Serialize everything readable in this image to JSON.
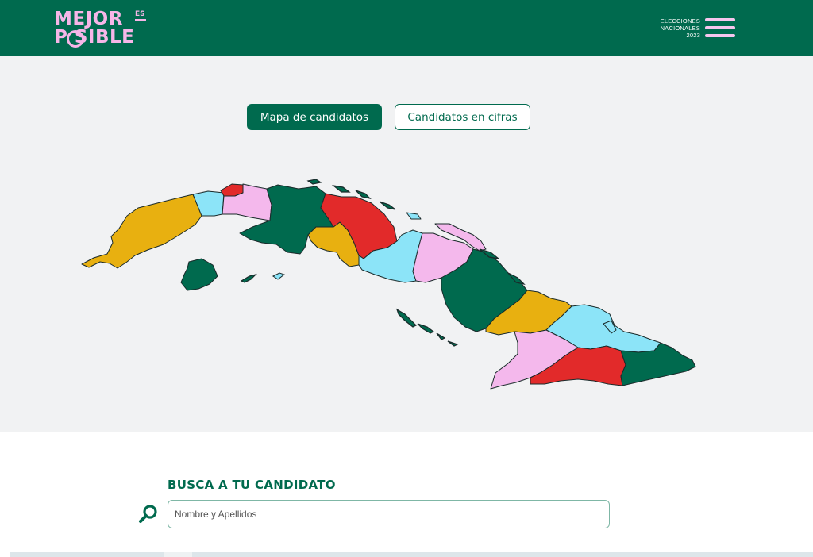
{
  "header": {
    "logo": {
      "line1": "MEJOR",
      "line2": "P SIBLE",
      "es": "ES"
    },
    "elections": {
      "line1": "ELECCIONES",
      "line2": "NACIONALES",
      "line3": "2023"
    },
    "menu_icon": "hamburger-icon"
  },
  "tabs": [
    {
      "label": "Mapa de candidatos",
      "active": true
    },
    {
      "label": "Candidatos en cifras",
      "active": false
    }
  ],
  "search": {
    "title": "BUSCA A TU CANDIDATO",
    "placeholder": "Nombre y Apellidos",
    "value": "",
    "icon": "search-icon"
  },
  "colors": {
    "brand_green": "#006a4e",
    "pink": "#f6b6e8",
    "map_yellow": "#e8b010",
    "map_cyan": "#8ce4f8",
    "map_pink": "#f4b8ec",
    "map_red": "#e22a2a",
    "map_green": "#006a4e",
    "map_background": "#f1f2f3"
  }
}
